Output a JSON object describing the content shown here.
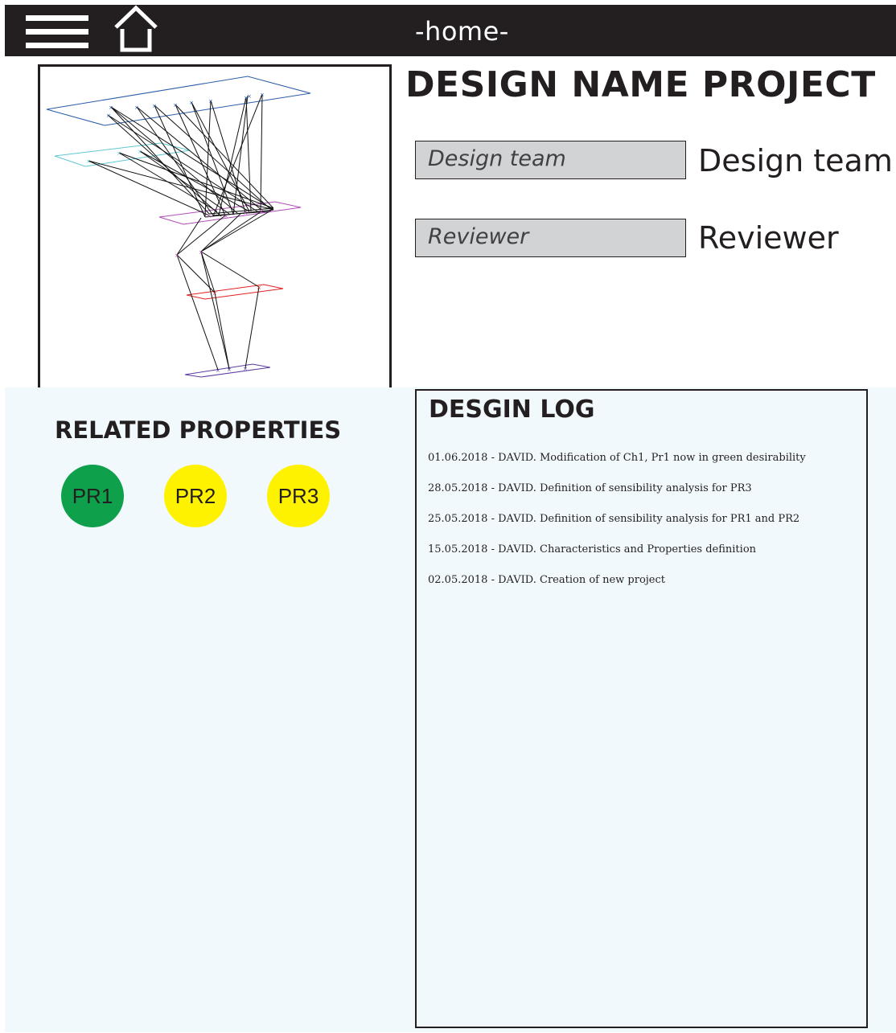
{
  "topbar": {
    "title": "-home-",
    "menu_icon": "hamburger-menu-icon",
    "home_icon": "home-icon"
  },
  "project": {
    "title": "DESIGN NAME PROJECT"
  },
  "fields": [
    {
      "placeholder": "Design team",
      "label": "Design team"
    },
    {
      "placeholder": "Reviewer",
      "label": "Reviewer"
    }
  ],
  "related": {
    "title": "RELATED PROPERTIES",
    "properties": [
      {
        "label": "PR1",
        "color": "#0ea04b"
      },
      {
        "label": "PR2",
        "color": "#fff200"
      },
      {
        "label": "PR3",
        "color": "#fff200"
      }
    ]
  },
  "log": {
    "title": "DESGIN LOG",
    "entries": [
      "01.06.2018 - DAVID. Modification of Ch1, Pr1 now in green desirability",
      "28.05.2018 - DAVID. Definition of sensibility analysis for PR3",
      "25.05.2018 - DAVID. Definition of sensibility analysis for PR1 and PR2",
      "15.05.2018 - DAVID. Characteristics and Properties definition",
      "02.05.2018 - DAVID. Creation of new project"
    ]
  },
  "colors": {
    "topbar": "#231f20",
    "panel_background": "#f1f9fc",
    "field_background": "#d1d3d4"
  }
}
